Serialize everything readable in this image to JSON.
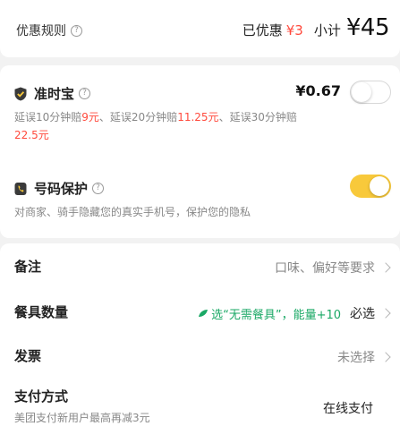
{
  "discount_rules": {
    "label": "优惠规则",
    "help_icon": "question-circle-icon"
  },
  "summary": {
    "discount_label": "已优惠",
    "discount_value": "¥3",
    "subtotal_label": "小计",
    "subtotal_value": "¥45"
  },
  "on_time": {
    "title": "准时宝",
    "icon": "shield-check-icon",
    "price": "¥0.67",
    "enabled": false,
    "desc_parts": [
      "延误10分钟赔",
      "9元",
      "、延误20分钟赔",
      "11.25元",
      "、延误30分钟赔",
      "22.5元"
    ]
  },
  "number_protection": {
    "title": "号码保护",
    "icon": "phone-icon",
    "enabled": true,
    "desc": "对商家、骑手隐藏您的真实手机号，保护您的隐私"
  },
  "remarks": {
    "label": "备注",
    "placeholder": "口味、偏好等要求"
  },
  "tableware": {
    "label": "餐具数量",
    "promo": "选“无需餐具”，能量+10",
    "required": "必选"
  },
  "invoice": {
    "label": "发票",
    "value": "未选择"
  },
  "payment": {
    "label": "支付方式",
    "sub": "美团支付新用户最高再减3元",
    "value": "在线支付"
  },
  "colors": {
    "accent_red": "#ff4a3d",
    "toggle_on": "#f8c93b",
    "promo_green": "#1aa865"
  }
}
